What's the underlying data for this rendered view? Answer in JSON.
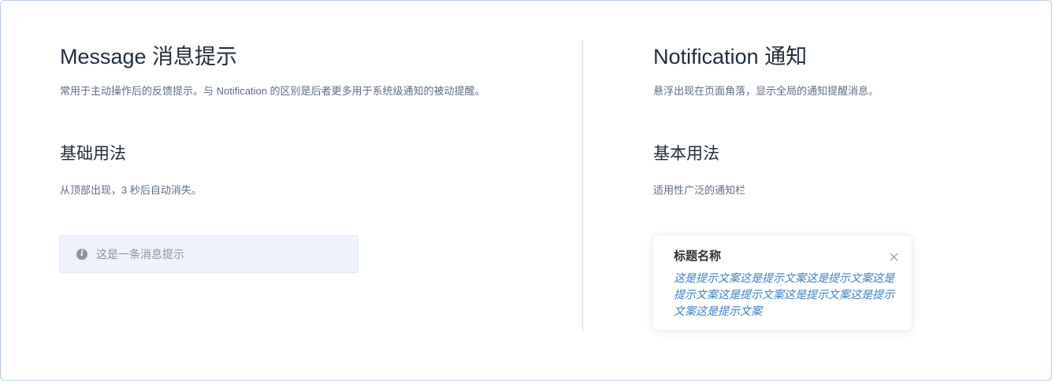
{
  "message_section": {
    "title": "Message 消息提示",
    "description": "常用于主动操作后的反馈提示。与 Notification 的区别是后者更多用于系统级通知的被动提醒。",
    "basic_title": "基础用法",
    "basic_description": "从顶部出现，3 秒后自动消失。",
    "message_box": {
      "icon": "info-icon",
      "text": "这是一条消息提示"
    }
  },
  "notification_section": {
    "title": "Notification 通知",
    "description": "悬浮出现在页面角落，显示全局的通知提醒消息。",
    "basic_title": "基本用法",
    "basic_description": "适用性广泛的通知栏",
    "notification_box": {
      "title": "标题名称",
      "content": "这是提示文案这是提示文案这是提示文案这是提示文案这是提示文案这是提示文案这是提示文案这是提示文案",
      "close_icon": "close-icon"
    }
  },
  "colors": {
    "border": "#b8cbe6",
    "heading": "#1f2d3d",
    "muted_text": "#5e6d82",
    "message_bg": "#edf2fc",
    "message_text": "#909399",
    "notification_content": "#3c7fc8"
  }
}
